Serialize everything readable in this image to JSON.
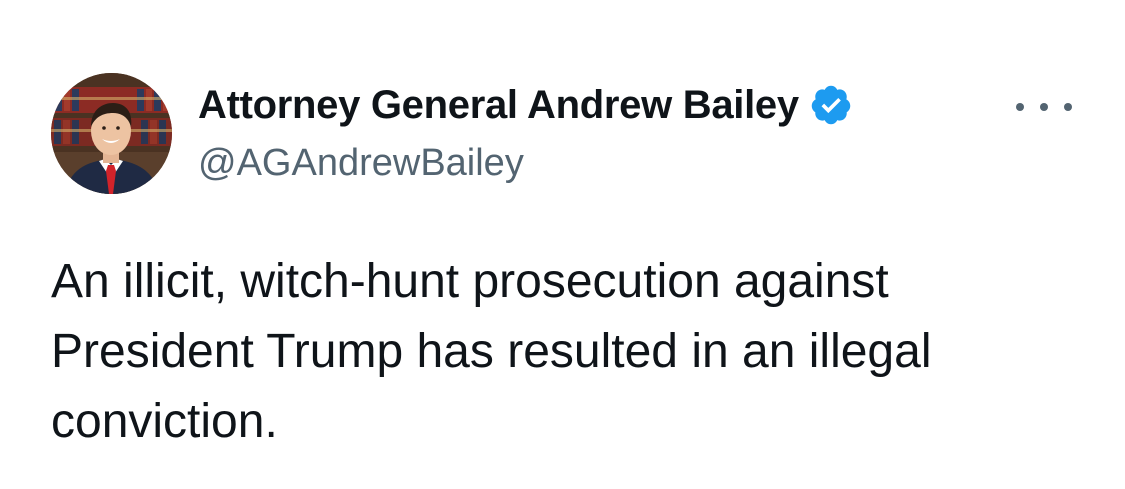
{
  "author": {
    "display_name": "Attorney General Andrew Bailey",
    "handle": "@AGAndrewBailey",
    "verified": true,
    "verified_color": "#1d9bf0"
  },
  "menu": {
    "more_icon": "more-options-icon"
  },
  "tweet": {
    "text": "An illicit, witch-hunt prosecution against\nPresident Trump has resulted in an illegal\nconviction."
  },
  "colors": {
    "text_primary": "#0f1419",
    "text_secondary": "#536471",
    "background": "#ffffff"
  }
}
